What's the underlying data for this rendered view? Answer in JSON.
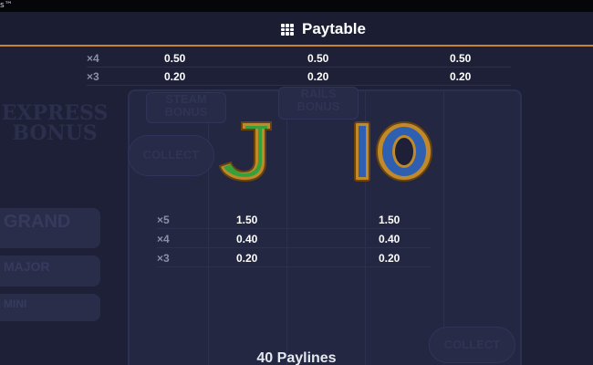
{
  "window": {
    "title": "s™"
  },
  "header": {
    "icon": "grid-menu-icon",
    "title": "Paytable"
  },
  "background": {
    "labels": [
      "STEAM BONUS",
      "RAILS BONUS",
      "EXPRESS BONUS",
      "COLLECT",
      "GRAND",
      "MAJOR",
      "MINI"
    ]
  },
  "top_table": {
    "rows": [
      {
        "mult": "×4",
        "values": [
          "0.50",
          "0.50",
          "0.50"
        ]
      },
      {
        "mult": "×3",
        "values": [
          "0.20",
          "0.20",
          "0.20"
        ]
      }
    ]
  },
  "symbols": [
    {
      "name": "J",
      "color": "#3aa13a",
      "icon": "letter-j-symbol"
    },
    {
      "name": "10",
      "color": "#2f5fb0",
      "icon": "number-ten-symbol"
    }
  ],
  "mid_table": {
    "rows": [
      {
        "mult": "×5",
        "values": [
          "1.50",
          "1.50"
        ]
      },
      {
        "mult": "×4",
        "values": [
          "0.40",
          "0.40"
        ]
      },
      {
        "mult": "×3",
        "values": [
          "0.20",
          "0.20"
        ]
      }
    ]
  },
  "footer": {
    "title": "40 Paylines"
  },
  "colors": {
    "accent": "#c8832e",
    "background": "#1d2036"
  }
}
